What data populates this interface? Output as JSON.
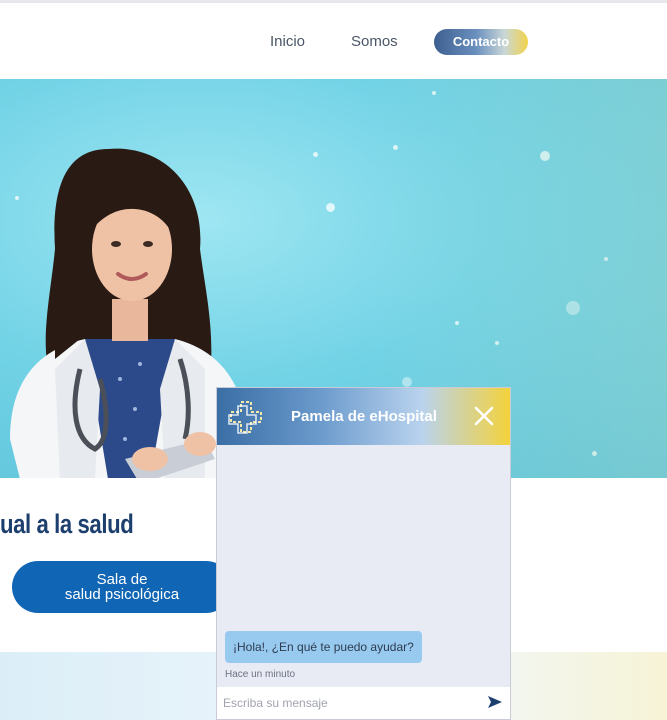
{
  "nav": {
    "items": [
      {
        "label": "Inicio"
      },
      {
        "label": "Somos"
      }
    ],
    "contact_label": "Contacto"
  },
  "hero": {
    "headline": "ual a la salud",
    "button_line1": "Sala de",
    "button_line2": "salud psicológica"
  },
  "chat": {
    "title": "Pamela de eHospital",
    "message": "¡Hola!, ¿En qué te puedo ayudar?",
    "timestamp": "Hace un minuto",
    "input_placeholder": "Escriba su mensaje",
    "icons": [
      "cross-logo-icon",
      "close-icon",
      "send-icon"
    ]
  },
  "colors": {
    "brand_blue": "#1066b4",
    "headline": "#1d3f6e",
    "accent_yellow": "#f2d34a",
    "bubble": "#98caf0"
  }
}
